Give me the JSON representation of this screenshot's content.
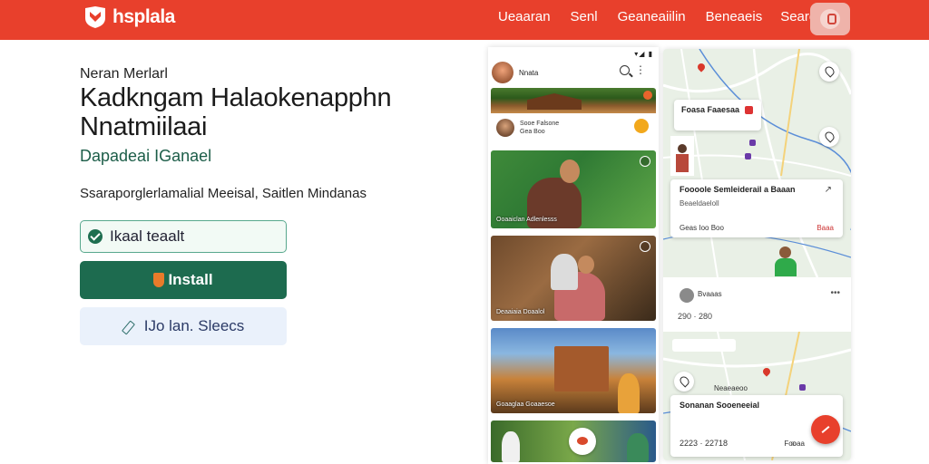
{
  "header": {
    "brand": "hsplala",
    "nav": [
      "Ueaaran",
      "Senl",
      "Geaneaiilin",
      "Beneaeis",
      "Seares"
    ],
    "colors": {
      "bar": "#e8402c"
    },
    "icons": {
      "logo": "shield-logo-icon",
      "account": "account-avatar-icon"
    }
  },
  "hero": {
    "eyebrow": "Neran Merlarl",
    "headline": "Kadkngam Halaokenapphn Nnatmiilaai",
    "subhead": "Dapadeai IGanael",
    "description": "Ssaraporglerlamalial Meeisal, Saitlen Mindanas"
  },
  "actions": {
    "check_label": "Ikaal teaalt",
    "install_label": "Install",
    "secondary_label": "IJo lan. Sleecs",
    "colors": {
      "primary": "#1d6b4f",
      "check_border": "#58a88d",
      "secondary_bg": "#eaf1fb"
    }
  },
  "phone": {
    "status": "▾◢ ▮",
    "app_name": "Nnata",
    "cards": [
      {
        "caption": "Sooe Falsone",
        "sub": "Gea Boo"
      },
      {
        "caption": "Ooaaiclan Adlenlesss"
      },
      {
        "caption": "Deaaiaia Doaalol"
      },
      {
        "caption": "Goaaglaa Goaaesoe"
      },
      {
        "caption": ""
      }
    ]
  },
  "map_panel": {
    "card1_title": "Foasa Faaesaa",
    "card2_title": "Foooole Semleiderail a Baaan",
    "card2_sub": "Beaeldaeloll",
    "card2_foot_left": "Geas Ioo Boo",
    "card2_foot_right": "Baaa",
    "feed_name": "Bvaaas",
    "feed_stats": "290 · 280",
    "card3_title": "Sonanan Sooeneeial",
    "card3_foot": "2223 · 22718",
    "card3_chip": "Fooaa",
    "nearby_label": "Neaeaeoo"
  }
}
